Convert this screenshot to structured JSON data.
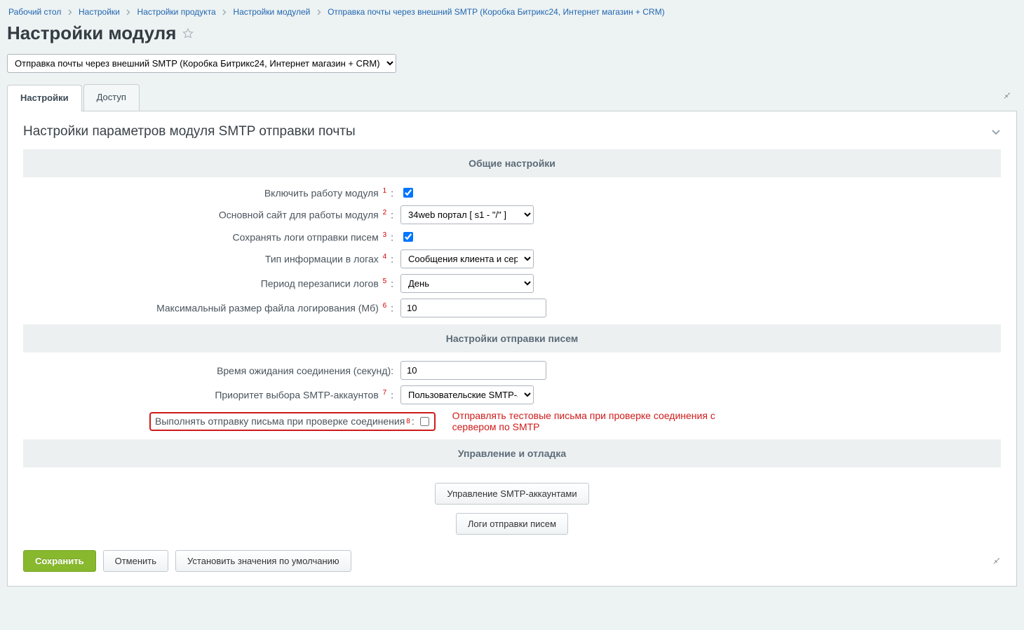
{
  "breadcrumbs": {
    "items": [
      "Рабочий стол",
      "Настройки",
      "Настройки продукта",
      "Настройки модулей",
      "Отправка почты через внешний SMTP (Коробка Битрикс24, Интернет магазин + CRM)"
    ]
  },
  "page_title": "Настройки модуля",
  "module_select": {
    "value": "Отправка почты через внешний SMTP (Коробка Битрикс24, Интернет магазин + CRM)"
  },
  "tabs": {
    "settings": "Настройки",
    "access": "Доступ"
  },
  "panel_title": "Настройки параметров модуля SMTP отправки почты",
  "sections": {
    "general": "Общие настройки",
    "send": "Настройки отправки писем",
    "debug": "Управление и отладка"
  },
  "fields": {
    "enable": {
      "label": "Включить работу модуля",
      "note": "1",
      "checked": true
    },
    "main_site": {
      "label": "Основной сайт для работы модуля",
      "note": "2",
      "value": "34web портал [ s1 - \"/\" ]"
    },
    "save_logs": {
      "label": "Сохранять логи отправки писем",
      "note": "3",
      "checked": true
    },
    "log_type": {
      "label": "Тип информации в логах",
      "note": "4",
      "value": "Сообщения клиента и серве"
    },
    "log_period": {
      "label": "Период перезаписи логов",
      "note": "5",
      "value": "День"
    },
    "log_size": {
      "label": "Максимальный размер файла логирования (Мб)",
      "note": "6",
      "value": "10"
    },
    "timeout": {
      "label": "Время ожидания соединения (секунд):",
      "value": "10"
    },
    "priority": {
      "label": "Приоритет выбора SMTP-аккаунтов",
      "note": "7",
      "value": "Пользовательские SMTP-ак"
    },
    "test_send": {
      "label": "Выполнять отправку письма при проверке соединения",
      "note": "8",
      "checked": false,
      "hint": "Отправлять тестовые письма при проверке соединения с сервером по SMTP"
    }
  },
  "mgmt_buttons": {
    "accounts": "Управление SMTP-аккаунтами",
    "logs": "Логи отправки писем"
  },
  "footer": {
    "save": "Сохранить",
    "cancel": "Отменить",
    "defaults": "Установить значения по умолчанию"
  }
}
